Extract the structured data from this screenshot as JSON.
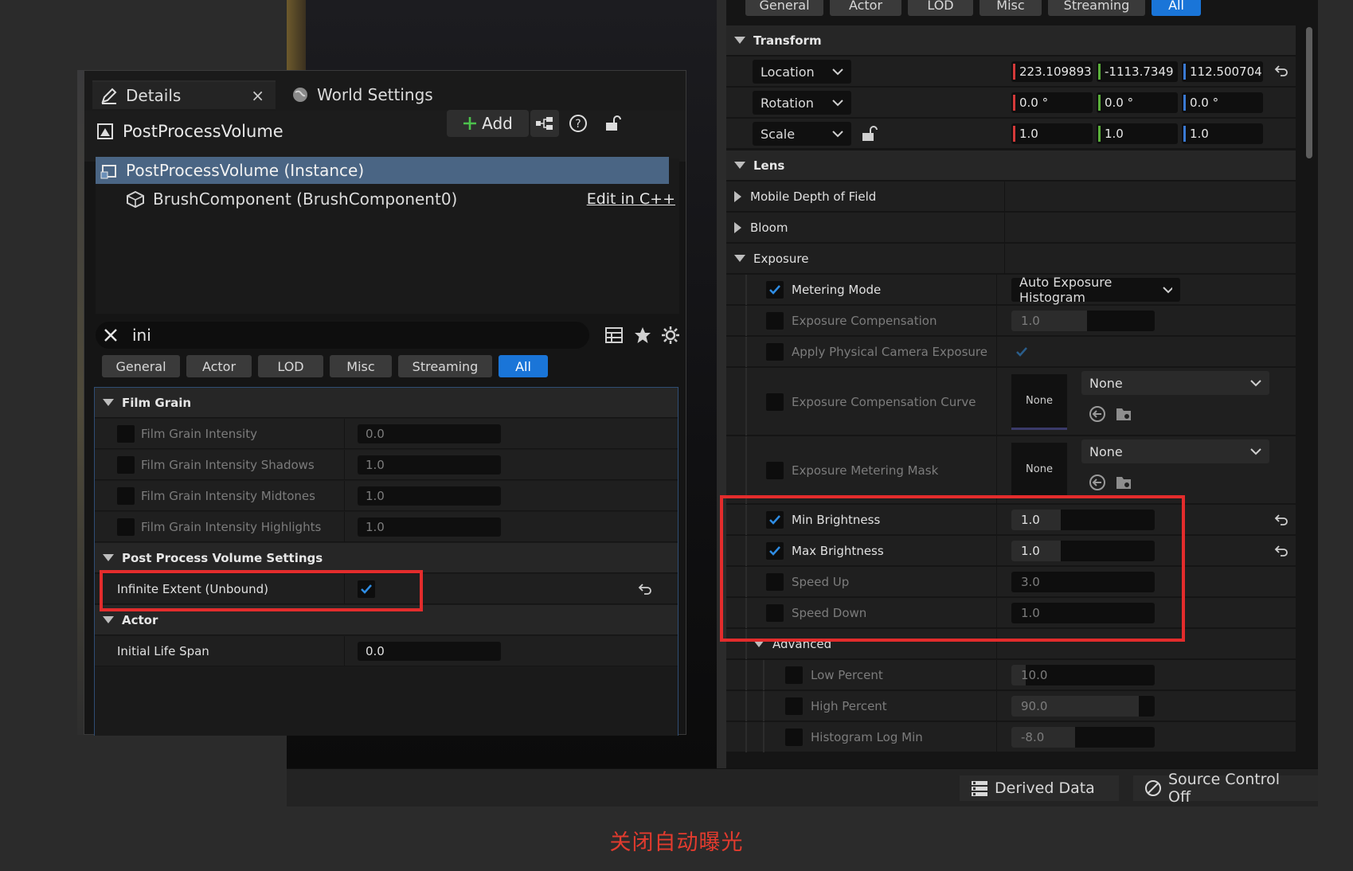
{
  "details_panel": {
    "tab_details": "Details",
    "tab_close": "×",
    "tab_world_settings": "World Settings",
    "object_name": "PostProcessVolume",
    "add_label": "Add",
    "tree": {
      "instance": "PostProcessVolume (Instance)",
      "component": "BrushComponent (BrushComponent0)",
      "edit_link": "Edit in C++"
    },
    "search_value": "ini",
    "filters": [
      "General",
      "Actor",
      "LOD",
      "Misc",
      "Streaming",
      "All"
    ],
    "active_filter": "All",
    "categories": {
      "film_grain": "Film Grain",
      "ppv_settings": "Post Process Volume Settings",
      "actor": "Actor"
    },
    "film_grain_rows": [
      {
        "label": "Film Grain Intensity",
        "value": "0.0",
        "checked": false
      },
      {
        "label": "Film Grain Intensity Shadows",
        "value": "1.0",
        "checked": false
      },
      {
        "label": "Film Grain Intensity Midtones",
        "value": "1.0",
        "checked": false
      },
      {
        "label": "Film Grain Intensity Highlights",
        "value": "1.0",
        "checked": false
      }
    ],
    "infinite_extent": {
      "label": "Infinite Extent (Unbound)",
      "checked": true
    },
    "initial_life_span": {
      "label": "Initial Life Span",
      "value": "0.0"
    }
  },
  "right_panel": {
    "filters": [
      "General",
      "Actor",
      "LOD",
      "Misc",
      "Streaming",
      "All"
    ],
    "active_filter": "All",
    "transform": {
      "category": "Transform",
      "location": {
        "label": "Location",
        "x": "223.109893",
        "y": "-1113.7349",
        "z": "112.500704"
      },
      "rotation": {
        "label": "Rotation",
        "x": "0.0 °",
        "y": "0.0 °",
        "z": "0.0 °"
      },
      "scale": {
        "label": "Scale",
        "x": "1.0",
        "y": "1.0",
        "z": "1.0"
      }
    },
    "lens": {
      "category": "Lens",
      "mobile_dof": "Mobile Depth of Field",
      "bloom": "Bloom",
      "exposure": "Exposure"
    },
    "exposure_rows": {
      "metering_mode": {
        "label": "Metering Mode",
        "value": "Auto Exposure Histogram",
        "checked": true
      },
      "exposure_compensation": {
        "label": "Exposure Compensation",
        "value": "1.0",
        "checked": false
      },
      "apply_physical": {
        "label": "Apply Physical Camera Exposure",
        "checked": false
      },
      "comp_curve": {
        "label": "Exposure Compensation Curve",
        "thumb": "None",
        "asset": "None"
      },
      "metering_mask": {
        "label": "Exposure Metering Mask",
        "thumb": "None",
        "asset": "None"
      },
      "min_brightness": {
        "label": "Min Brightness",
        "value": "1.0",
        "checked": true
      },
      "max_brightness": {
        "label": "Max Brightness",
        "value": "1.0",
        "checked": true
      },
      "speed_up": {
        "label": "Speed Up",
        "value": "3.0",
        "checked": false
      },
      "speed_down": {
        "label": "Speed Down",
        "value": "1.0",
        "checked": false
      }
    },
    "advanced": {
      "category": "Advanced",
      "low_percent": {
        "label": "Low Percent",
        "value": "10.0"
      },
      "high_percent": {
        "label": "High Percent",
        "value": "90.0"
      },
      "hist_log_min": {
        "label": "Histogram Log Min",
        "value": "-8.0"
      }
    }
  },
  "status_bar": {
    "derived_data": "Derived Data",
    "source_control": "Source Control Off"
  },
  "caption": "关闭自动曝光",
  "colors": {
    "accent": "#1a75d8",
    "selection": "#4a6584",
    "highlight_box": "#e32c2c",
    "axis_x": "#d43a3a",
    "axis_y": "#5ab03a",
    "axis_z": "#3a7ad4"
  }
}
